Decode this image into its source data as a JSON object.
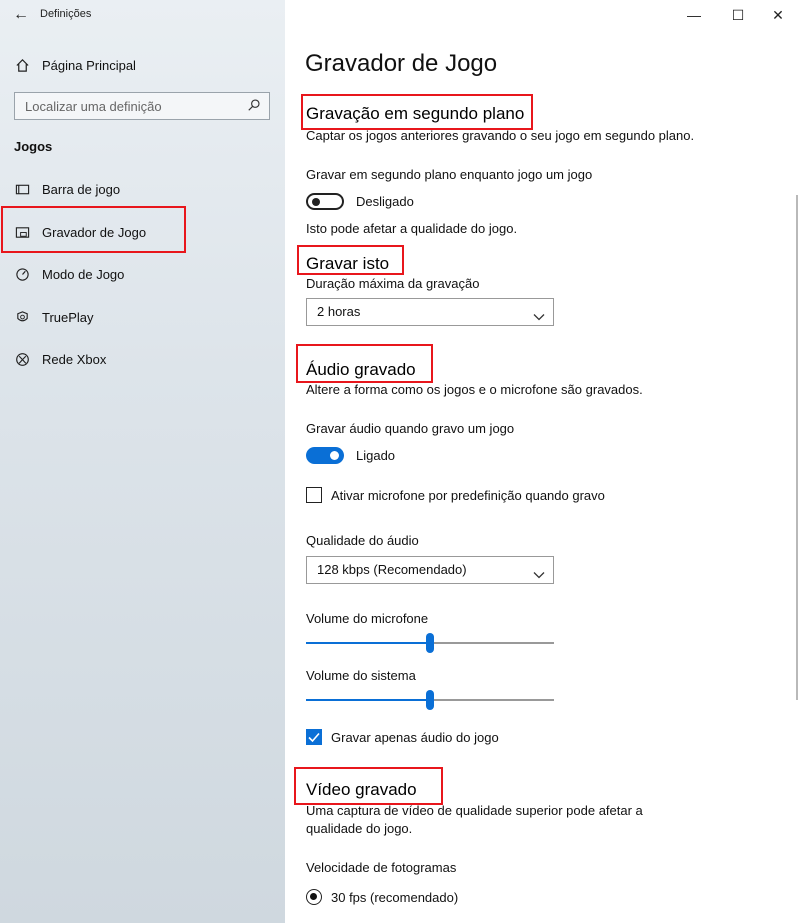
{
  "window": {
    "app_title": "Definições",
    "back_glyph": "←",
    "minimize_glyph": "—",
    "maximize_glyph": "☐",
    "close_glyph": "✕"
  },
  "sidebar": {
    "home_label": "Página Principal",
    "search_placeholder": "Localizar uma definição",
    "section_title": "Jogos",
    "items": [
      {
        "label": "Barra de jogo",
        "icon": "game-bar-icon"
      },
      {
        "label": "Gravador de Jogo",
        "icon": "game-recorder-icon",
        "selected": true
      },
      {
        "label": "Modo de Jogo",
        "icon": "game-mode-icon"
      },
      {
        "label": "TruePlay",
        "icon": "trueplay-icon"
      },
      {
        "label": "Rede Xbox",
        "icon": "xbox-icon"
      }
    ]
  },
  "main": {
    "title": "Gravador de Jogo",
    "background": {
      "heading": "Gravação em segundo plano",
      "description": "Captar os jogos anteriores gravando o seu jogo em segundo plano.",
      "toggle_label": "Gravar em segundo plano enquanto jogo um jogo",
      "toggle_state": "Desligado",
      "toggle_on": false,
      "note": "Isto pode afetar a qualidade do jogo."
    },
    "record_this": {
      "heading": "Gravar isto",
      "duration_label": "Duração máxima da gravação",
      "duration_value": "2 horas"
    },
    "audio": {
      "heading": "Áudio gravado",
      "description": "Altere a forma como os jogos e o microfone são gravados.",
      "toggle_label": "Gravar áudio quando gravo um jogo",
      "toggle_state": "Ligado",
      "toggle_on": true,
      "mic_default_label": "Ativar microfone por predefinição quando gravo",
      "mic_default_checked": false,
      "quality_label": "Qualidade do áudio",
      "quality_value": "128 kbps (Recomendado)",
      "mic_volume_label": "Volume do microfone",
      "mic_volume": 0.5,
      "system_volume_label": "Volume do sistema",
      "system_volume": 0.5,
      "game_audio_only_label": "Gravar apenas áudio do jogo",
      "game_audio_only_checked": true
    },
    "video": {
      "heading": "Vídeo gravado",
      "description_line1": "Uma captura de vídeo de qualidade superior pode afetar a",
      "description_line2": "qualidade do jogo.",
      "framerate_label": "Velocidade de fotogramas",
      "framerate_value": "30 fps (recomendado)"
    }
  },
  "colors": {
    "accent": "#0a6fd6",
    "highlight": "#e8161c"
  }
}
